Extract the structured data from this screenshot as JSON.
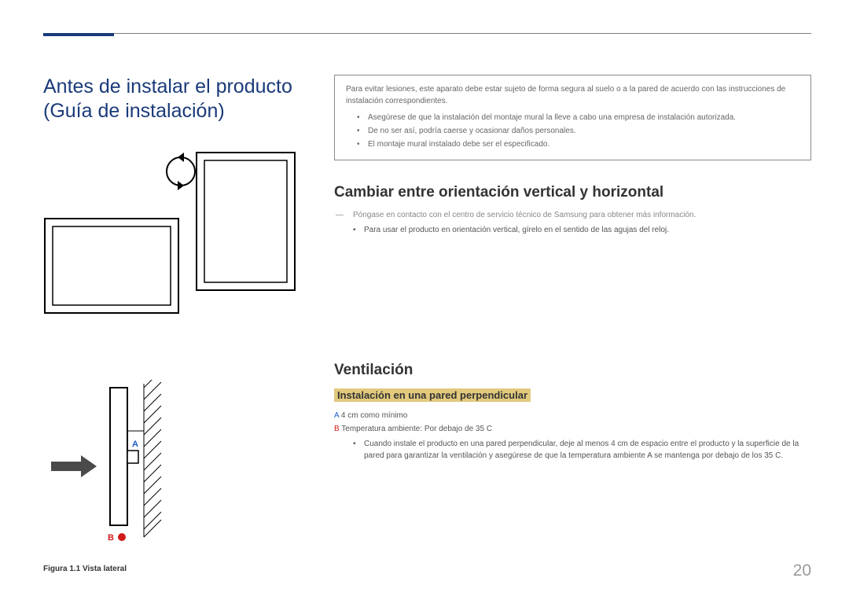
{
  "page_number": "20",
  "left": {
    "main_title": "Antes de instalar el producto (Guía de instalación)",
    "figure_caption": "Figura 1.1 Vista lateral",
    "diagram_labels": {
      "A": "A",
      "B": "B"
    }
  },
  "right": {
    "warning": {
      "intro": "Para evitar lesiones, este aparato debe estar sujeto de forma segura al suelo o a la pared de acuerdo con las instrucciones de instalación correspondientes.",
      "bullets": [
        "Asegúrese de que la instalación del montaje mural la lleve a cabo una empresa de instalación autorizada.",
        "De no ser así, podría caerse y ocasionar daños personales.",
        "El montaje mural instalado debe ser el especificado."
      ]
    },
    "orientation": {
      "heading": "Cambiar entre orientación vertical y horizontal",
      "note": "Póngase en contacto con el centro de servicio técnico de Samsung para obtener más información.",
      "bullets": [
        "Para usar el producto en orientación vertical, gírelo en el sentido de las agujas del reloj."
      ]
    },
    "ventilation": {
      "heading": "Ventilación",
      "sub_heading": "Instalación en una pared perpendicular",
      "spec_A_label": "A",
      "spec_A_text": " 4 cm como mínimo",
      "spec_B_label": "B",
      "spec_B_text": " Temperatura ambiente: Por debajo de 35 C",
      "bullets": [
        "Cuando instale el producto en una pared perpendicular, deje al menos 4 cm de espacio entre el producto y la superficie de la pared para garantizar la ventilación y asegúrese de que la temperatura ambiente A se mantenga por debajo de los 35 C."
      ]
    }
  }
}
